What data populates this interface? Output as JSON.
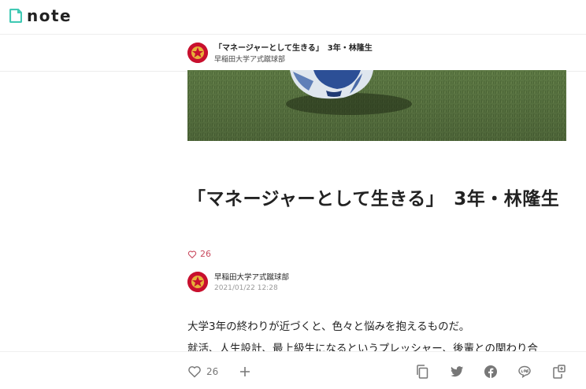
{
  "header": {
    "logo_text": "note"
  },
  "sticky": {
    "title": "「マネージャーとして生きる」　3年・林隆生",
    "author": "早稲田大学ア式蹴球部"
  },
  "article": {
    "title": "「マネージャーとして生きる」　3年・林隆生",
    "like_count": "26",
    "author": "早稲田大学ア式蹴球部",
    "date": "2021/01/22 12:28",
    "body": [
      "大学3年の終わりが近づくと、色々と悩みを抱えるものだ。",
      "就活、人生設計、最上級生になるというプレッシャー、後輩との関わり合"
    ]
  },
  "actions": {
    "like_count": "26",
    "icons": [
      "heart-icon",
      "plus-icon",
      "copy-icon",
      "twitter-icon",
      "facebook-icon",
      "line-icon",
      "embed-icon"
    ]
  },
  "colors": {
    "brand_green": "#41c9b4",
    "like_pink": "#c94a5e",
    "avatar_red": "#c8102e",
    "grass": "#5f7c45"
  }
}
